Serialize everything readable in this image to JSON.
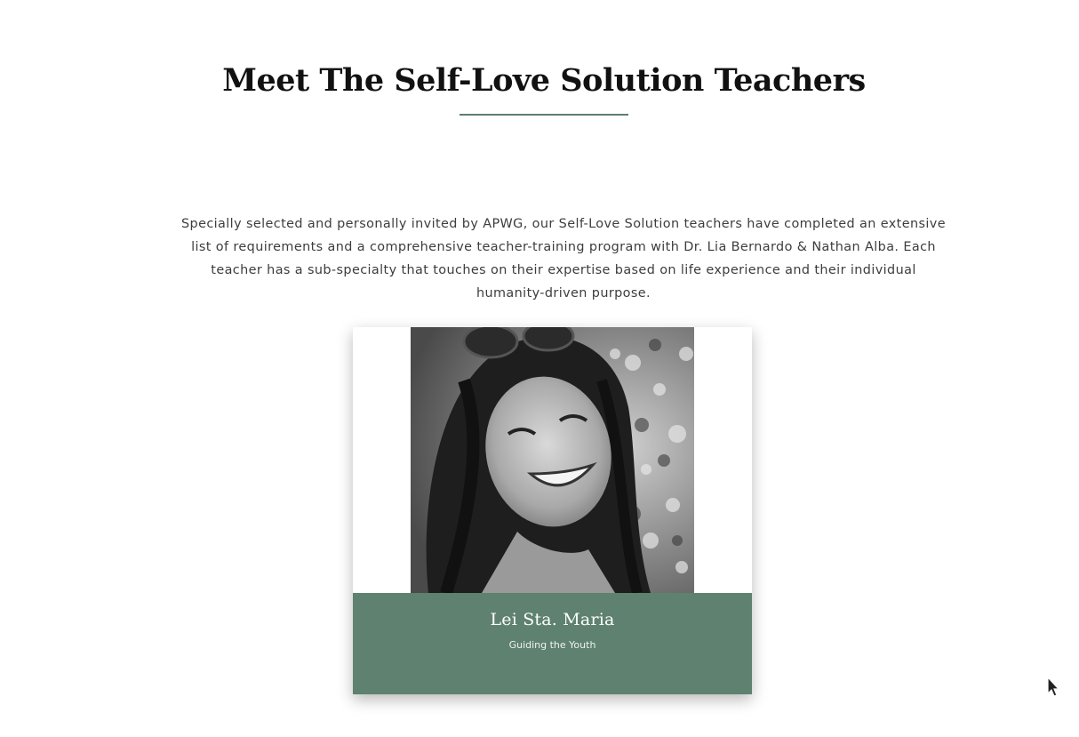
{
  "section": {
    "title": "Meet The Self-Love Solution Teachers",
    "intro": "Specially selected and personally invited by APWG, our Self-Love Solution teachers have completed an extensive list of requirements and a comprehensive teacher-training program with Dr. Lia Bernardo & Nathan Alba. Each teacher has a sub-specialty that touches on their expertise based on life experience and their individual humanity-driven purpose."
  },
  "teacher_card": {
    "name": "Lei Sta. Maria",
    "specialty": "Guiding the Youth",
    "photo_alt": "Lei Sta. Maria"
  },
  "colors": {
    "accent_green": "#5f8170",
    "underline": "#5f7d6f",
    "title_text": "#111111"
  },
  "icons": {
    "cursor": "mouse-pointer-icon"
  }
}
